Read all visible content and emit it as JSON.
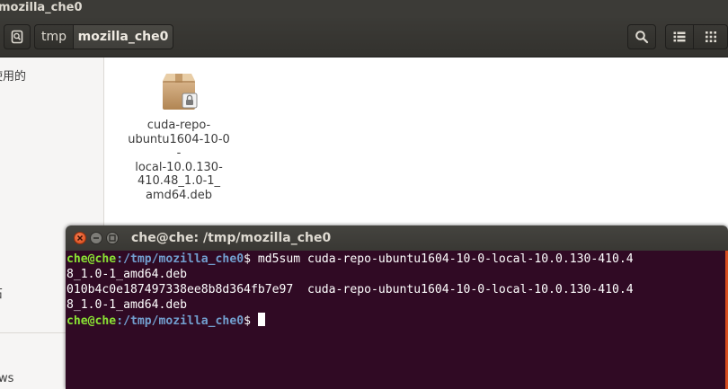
{
  "file_manager": {
    "window_title": "mozilla_che0",
    "breadcrumb": [
      "tmp",
      "mozilla_che0"
    ],
    "sidebar": {
      "items": [
        {
          "label": "使用的"
        },
        {
          "label": "石"
        },
        {
          "label": "ows"
        }
      ]
    },
    "files": [
      {
        "name": "cuda-repo-ubuntu1604-10-0-local-10.0.130-410.48_1.0-1_amd64.deb",
        "display_lines": [
          "cuda-repo-",
          "ubuntu1604-10-0-",
          "local-10.0.130-",
          "410.48_1.0-1_",
          "amd64.deb"
        ],
        "icon": "package-icon"
      }
    ],
    "toolbar_icons": [
      "back-icon",
      "search-icon",
      "list-view-icon",
      "grid-view-icon"
    ]
  },
  "terminal": {
    "title": "che@che: /tmp/mozilla_che0",
    "prompt_user": "che@che",
    "prompt_path": ":/tmp/mozilla_che0",
    "prompt_symbol": "$ ",
    "command": "md5sum cuda-repo-ubuntu1604-10-0-local-10.0.130-410.48_1.0-1_amd64.deb",
    "lines": [
      {
        "kind": "prompt",
        "text": "md5sum cuda-repo-ubuntu1604-10-0-local-10.0.130-410.4"
      },
      {
        "kind": "output",
        "text": "8_1.0-1_amd64.deb"
      },
      {
        "kind": "output",
        "text": "010b4c0e187497338ee8b8d364fb7e97  cuda-repo-ubuntu1604-10-0-local-10.0.130-410.4"
      },
      {
        "kind": "output",
        "text": "8_1.0-1_amd64.deb"
      },
      {
        "kind": "prompt",
        "text": ""
      }
    ],
    "colors": {
      "background": "#300a24",
      "user": "#8ae234",
      "path": "#729fcf",
      "accent": "#e95420"
    }
  }
}
